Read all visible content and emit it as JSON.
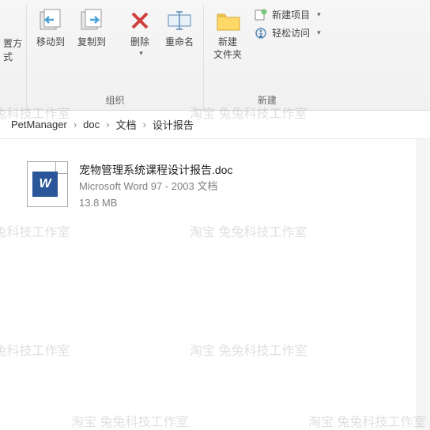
{
  "ribbon": {
    "group_org_label": "组织",
    "group_new_label": "新建",
    "moveTo": "移动到",
    "copyTo": "复制到",
    "delete": "删除",
    "rename": "重命名",
    "newFolder": "新建\n文件夹",
    "newItem": "新建项目",
    "easyAccess": "轻松访问",
    "leftFrag": "置方式"
  },
  "breadcrumb": {
    "p1": "PetManager",
    "p2": "doc",
    "p3": "文档",
    "p4": "设计报告"
  },
  "file": {
    "name": "宠物管理系统课程设计报告.doc",
    "type": "Microsoft Word 97 - 2003 文档",
    "size": "13.8 MB",
    "iconLetter": "W"
  },
  "watermark": "淘宝 兔兔科技工作室"
}
